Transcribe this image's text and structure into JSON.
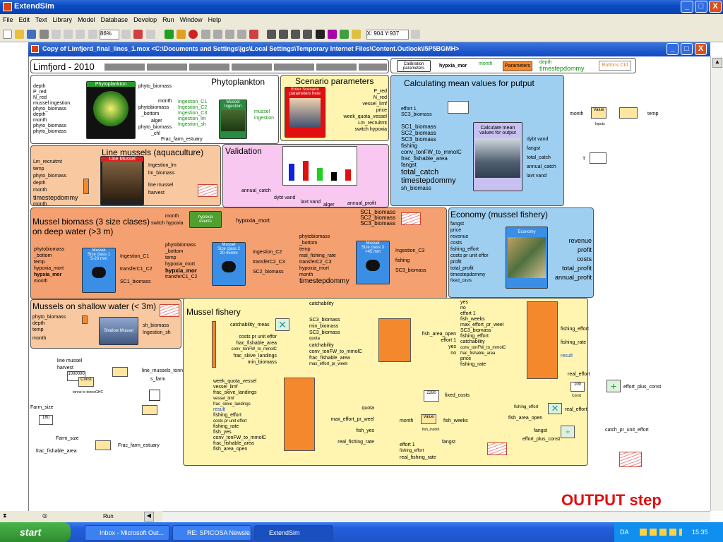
{
  "window": {
    "title": "ExtendSim",
    "minimize": "_",
    "maximize": "□",
    "close": "X"
  },
  "menu": [
    "File",
    "Edit",
    "Text",
    "Library",
    "Model",
    "Database",
    "Develop",
    "Run",
    "Window",
    "Help"
  ],
  "toolbar": {
    "zoom": "86%",
    "coords": "X: 904 Y:937"
  },
  "doc": {
    "title": "Copy of Limfjord_final_lines_1.mox   <C:\\Documents and Settings\\jgs\\Local Settings\\Temporary Internet Files\\Content.Outlook\\I5P5BGMH>"
  },
  "model": {
    "header": {
      "title": "Limfjord - 2010"
    },
    "calib": {
      "l1": "Calibration",
      "l2": "parameters",
      "hypo": "hypxia_mor",
      "month": "month",
      "params": "Parameters",
      "depth": "depth",
      "timestep": "timestepdommy",
      "buttons": "Buttons Ctrl"
    },
    "phyto": {
      "title": "Phytoplankton",
      "block": "Phytoplankton",
      "inputs": [
        "depth",
        "P_red",
        "N_red",
        "mussel ingestion",
        "phyto_biomass",
        "depth",
        "month",
        "phyto_biomass",
        "phyto_biomass"
      ],
      "phyto_out": "phyto_biomass",
      "month": "month",
      "pb": "phytobiomass",
      "bottom": "_bottom",
      "alger": "alger",
      "pb2": "phyto_biomass",
      "chl": "_chl",
      "ing": [
        "Ingestion_C1",
        "Ingestion_C2",
        "Ingestion_C3",
        "Ingestion_lm",
        "Ingestion_sh"
      ],
      "frac": "Frac_farm_estuary",
      "m1": "Mussel",
      "m2": "Ingestion",
      "mi": "mussel",
      "mi2": "ingestion"
    },
    "scenario": {
      "title": "Scenario parameters",
      "enter": "Enter Scenario",
      "para": "parameters here",
      "outs": [
        "P_red",
        "N_red",
        "vessel_limf",
        "price",
        "week_quota_vessel",
        "Lm_recruitmt",
        "switch hypoxia"
      ]
    },
    "mean": {
      "title": "Calculating mean values for putput",
      "effort": "effort 1",
      "sc3": "SC3_biomass",
      "inputs": [
        "SC1_biomass",
        "SC2_biomass",
        "SC3_biomass",
        "fishing",
        "conv_tonFW_to_mmolC",
        "frac_fishable_area",
        "fangst",
        "total_catch",
        "timestepdommy",
        "sh_biomass"
      ],
      "block": "Calculate mean values for output",
      "outs": [
        "dybt vand",
        "fangst",
        "total_catch",
        "annual_catch",
        "lavt vand"
      ]
    },
    "right": {
      "month": "month",
      "value": "Value",
      "inputs": "Inputs",
      "temp": "temp",
      "t": "T"
    },
    "lines": {
      "title": "Line mussels (aquaculture)",
      "block": "Line Mussel",
      "inputs": [
        "Lm_recruitmt",
        "temp",
        "phyto_biomass",
        "depth",
        "month",
        "timestepdommy",
        "month"
      ],
      "outs": [
        "Ingestion_lm",
        "lm_biomass",
        "line mussel",
        "harvest"
      ]
    },
    "valid": {
      "title": "Validation",
      "ann": "annual_catch",
      "dybt": "dybt vand",
      "lavt": "lavt vand",
      "alger": "alger",
      "ap": "annual_profit"
    },
    "biomass": {
      "title": "Mussel biomass (3 size clases)",
      "title2": "on deep water (>3 m)",
      "month": "month",
      "switch": "switch hypoxia",
      "hyp": "hypoxia",
      "events": "events",
      "hmort": "hypoxia_mort",
      "sc": [
        "SC1_biomass",
        "SC2_biomass",
        "SC3_biomass"
      ],
      "c1": {
        "inputs": [
          "phytobiomass",
          "_bottom",
          "temp",
          "hypoxia_mort",
          "hypxia_mor",
          "month"
        ],
        "name": "Mussel",
        "size": "Size class 1",
        "mm": "5-20 mm",
        "outs": [
          "Ingestion_C1",
          "transferC1_C2",
          "SC1_biomass"
        ]
      },
      "c2": {
        "inputs": [
          "phytobiomass",
          "_bottom",
          "temp",
          "hypoxia_mort",
          "hypxia_mor",
          "transferC1_C2"
        ],
        "name": "Mussel",
        "size": "Size class 2",
        "mm": "20-45mm",
        "outs": [
          "Ingestion_C2",
          "transferC2_C3",
          "SC2_biomass"
        ]
      },
      "c3": {
        "inputs": [
          "phytobiomass",
          "_bottom",
          "temp",
          "real_fishing_rate",
          "transferC2_C3",
          "hypoxia_mort",
          "month",
          "timestepdommy"
        ],
        "name": "Mussel",
        "size": "Size class 3",
        "mm": ">45 mm",
        "outs": [
          "Ingestion_C3",
          "fishing",
          "SC3_biomass"
        ]
      }
    },
    "economy": {
      "title": "Economy (mussel fishery)",
      "inputs": [
        "fangst",
        "price",
        "revenue",
        "costs",
        "fishing_effort",
        "costs pr unit effor",
        "profit",
        "total_profit",
        "timestepdommy",
        "fixed_costs"
      ],
      "block": "Economy",
      "outs": [
        "revenue",
        "profit",
        "costs",
        "total_profit",
        "annual_profit"
      ]
    },
    "shallow": {
      "title": "Mussels on shallow water (< 3m)",
      "inputs": [
        "phyto_biomass",
        "depth",
        "temp",
        "month"
      ],
      "block": "Shallow Mussel",
      "outs": [
        "sh_biomass",
        "Ingestion_sh"
      ]
    },
    "left": {
      "lm": "line mussel",
      "harv": "harvest",
      "val": "1000000",
      "lmt": "line_mussels_tonne",
      "sf": "s_farm",
      "fs": "Farm_size",
      "fs2": "Farm_size",
      "ffa": "frac_fishable_area",
      "ffe": "Frac_farm_estuary",
      "const": "Const",
      "tt": "tonne to tonneGHC",
      "fsv": "160"
    },
    "fishery": {
      "title": "Mussel fishery",
      "catch": "catchability",
      "cm": "catchability_meas",
      "cpu": "costs pr unit effor",
      "ffa": "frac_fishable_area",
      "conv": "conv_tonFW_to_mmolC",
      "fsl": "frac_skive_landings",
      "minb": "min_biomass",
      "area_in": [
        "SC3_biomass",
        "min_biomass",
        "SC3_biomass",
        "quota",
        "catchability",
        "conv_tonFW_to_mmolC",
        "frac_fishable_area",
        "max_effort_pr_week"
      ],
      "area_out": [
        "fish_area_open",
        "effort 1",
        "yes",
        "no"
      ],
      "q_in": [
        "week_quota_vessel",
        "vessel_limf",
        "frac_skive_landings",
        "vessel_limf",
        "frac_skive_landings",
        "result",
        "fishing_effort",
        "costs pr unit effort",
        "fishing_rate",
        "fish_yes",
        "conv_tonFW_to_mmolC",
        "frac_fishable_area",
        "fish_area_open"
      ],
      "q_out": [
        "quota",
        "max_effort_pr_weel",
        "fish_yes",
        "real_fishing_rate"
      ],
      "e_in": [
        "yes",
        "no",
        "effort 1",
        "fish_weeks",
        "max_effort_pr_weel",
        "SC3_biomass",
        "fishing_effort",
        "catchability",
        "conv_tonFW_to_mmolC",
        "frac_fishable_area",
        "price",
        "fishing_rate"
      ],
      "e_out": [
        "fishing_effort",
        "fishing_rate",
        "result"
      ],
      "fc": "fixed_costs",
      "fcv": "2280",
      "month": "month",
      "value": "Value",
      "fw": "fish_weeks",
      "fwl": "fish_month",
      "eff": "effort 1",
      "fe": "fishing_effort",
      "rfr": "real_fishing_rate",
      "fangst": "fangst",
      "fe2": "fishing_effort",
      "fao": "fish_area_open",
      "re": "real_effort",
      "epc": "effort_plus_const",
      "re2": "real_effort",
      "fangst2": "fangst",
      "epc2": "effort_plus_const",
      "cpu2": "catch_pr_unit_effort",
      "c100": "100",
      "c100b": "100",
      "const": "Const"
    },
    "output_label": "OUTPUT step"
  },
  "status": {
    "run": "Run"
  },
  "taskbar": {
    "start": "start",
    "tasks": [
      "Inbox - Microsoft Out...",
      "RE: SPICOSA Newsle...",
      "ExtendSim"
    ],
    "lang": "DA",
    "time": "15:35"
  },
  "colors": {
    "orange": "#f4a070",
    "lightblue": "#9ecff0",
    "pink": "#f8c8f0",
    "yellow": "#fff5b0",
    "peach": "#f8c8a0",
    "blueblock": "#3a8ee6"
  }
}
